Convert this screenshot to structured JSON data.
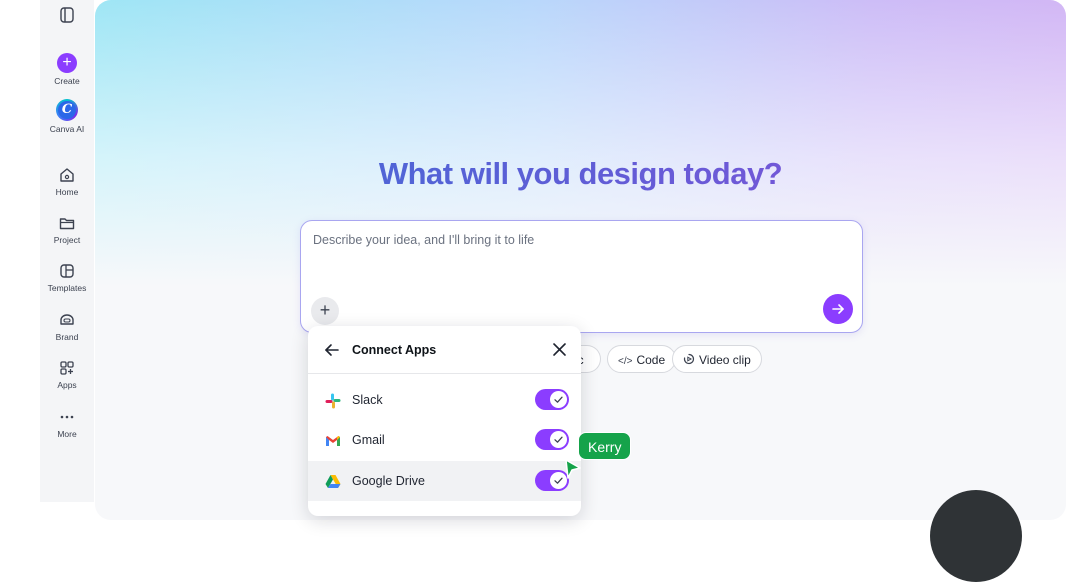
{
  "sidebar": {
    "items": [
      {
        "label": "Create",
        "icon": "plus-icon"
      },
      {
        "label": "Canva AI",
        "icon": "canva-ai-logo"
      },
      {
        "label": "Home",
        "icon": "home-icon"
      },
      {
        "label": "Project",
        "icon": "folder-icon"
      },
      {
        "label": "Templates",
        "icon": "templates-icon"
      },
      {
        "label": "Brand",
        "icon": "brand-icon"
      },
      {
        "label": "Apps",
        "icon": "apps-icon"
      },
      {
        "label": "More",
        "icon": "more-icon"
      }
    ],
    "canva_ai_letter": "C"
  },
  "hero": {
    "title": "What will you design today?",
    "prompt_placeholder": "Describe your idea, and I'll bring it to life",
    "prompt_value": ""
  },
  "chips": [
    {
      "label": "oc",
      "icon": ""
    },
    {
      "label": "Code",
      "icon": "</>"
    },
    {
      "label": "Video clip",
      "icon": "video-icon"
    }
  ],
  "connect_apps": {
    "title": "Connect Apps",
    "apps": [
      {
        "name": "Slack",
        "icon": "slack-icon",
        "enabled": true
      },
      {
        "name": "Gmail",
        "icon": "gmail-icon",
        "enabled": true
      },
      {
        "name": "Google Drive",
        "icon": "google-drive-icon",
        "enabled": true
      }
    ]
  },
  "cursor": {
    "name": "Kerry",
    "color": "#15a34a"
  },
  "colors": {
    "accent": "#8b3dff"
  }
}
